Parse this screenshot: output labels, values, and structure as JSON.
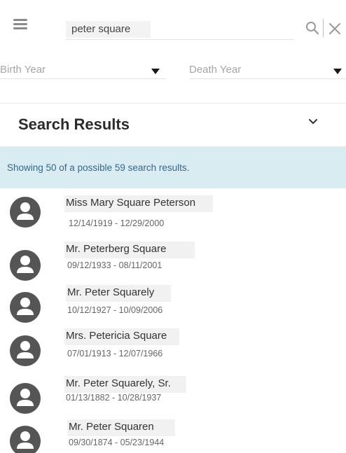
{
  "search": {
    "value": "peter square"
  },
  "filters": {
    "birth_year_label": "Birth Year",
    "death_year_label": "Death Year"
  },
  "results": {
    "title": "Search Results",
    "info": "Showing 50 of a possible 59 search results.",
    "items": [
      {
        "name": "Miss Mary Square Peterson",
        "dates": "12/14/1919 - 12/29/2000"
      },
      {
        "name": "Mr. Peterberg Square",
        "dates": "09/12/1933 - 08/11/2001"
      },
      {
        "name": "Mr. Peter Squarely",
        "dates": "10/12/1927 - 10/09/2006"
      },
      {
        "name": "Mrs. Petericia Square",
        "dates": "07/01/1913 - 12/07/1966"
      },
      {
        "name": "Mr. Peter Squarely, Sr.",
        "dates": "01/13/1882 - 10/28/1937"
      },
      {
        "name": "Mr. Peter Squaren",
        "dates": "09/30/1874 - 05/23/1944"
      }
    ]
  },
  "colors": {
    "banner_bg": "#d8ecf2",
    "banner_text": "#33698a",
    "avatar": "#555555"
  }
}
